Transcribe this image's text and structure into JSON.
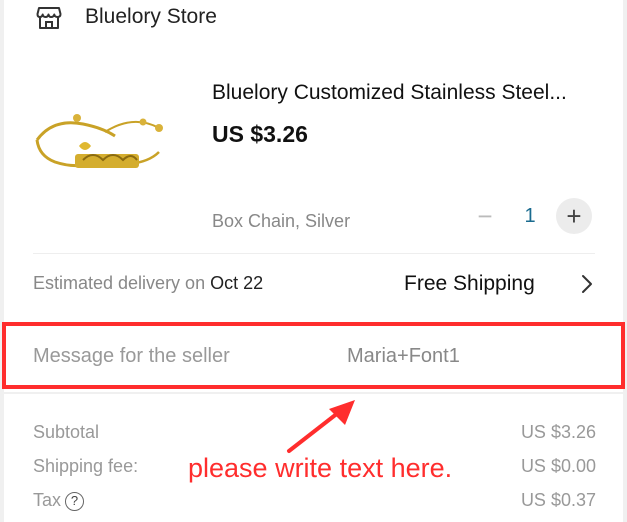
{
  "store": {
    "name": "Bluelory Store",
    "icon": "store-icon"
  },
  "product": {
    "title": "Bluelory Customized Stainless Steel...",
    "price": "US $3.26",
    "variant": "Box Chain, Silver",
    "quantity": "1",
    "minus_label": "−",
    "plus_label": "+"
  },
  "delivery": {
    "label": "Estimated delivery on",
    "date": "Oct 22",
    "shipping": "Free Shipping"
  },
  "message": {
    "label": "Message for the seller",
    "value": "Maria+Font1"
  },
  "summary": {
    "subtotal_label": "Subtotal",
    "subtotal_value": "US $3.26",
    "shipping_label": "Shipping fee:",
    "shipping_value": "US $0.00",
    "tax_label": "Tax",
    "tax_value": "US $0.37"
  },
  "annotation": {
    "text": "please write text here.",
    "color": "#ff2d2d"
  }
}
